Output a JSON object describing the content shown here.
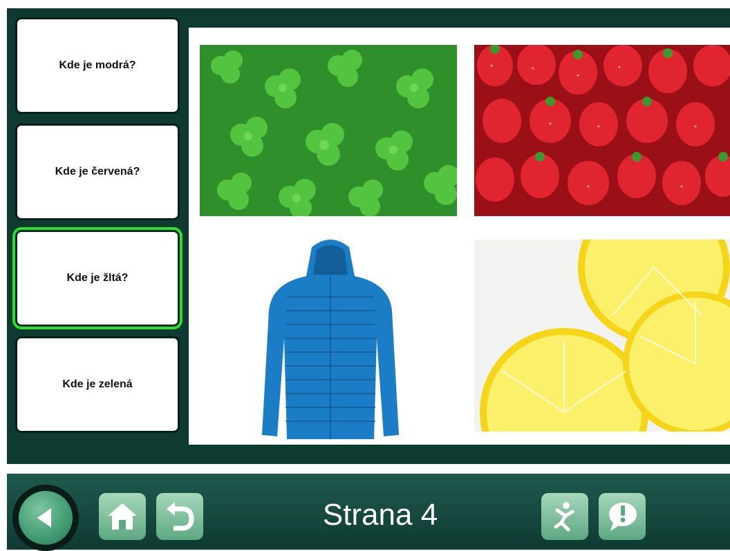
{
  "questions": [
    {
      "label": "Kde je modrá?",
      "selected": false
    },
    {
      "label": "Kde je červená?",
      "selected": false
    },
    {
      "label": "Kde je žltá?",
      "selected": true
    },
    {
      "label": "Kde je zelená",
      "selected": false
    }
  ],
  "images": [
    {
      "name": "clover-leaves-image",
      "color": "#3aa83a"
    },
    {
      "name": "strawberries-image",
      "color": "#d81e2a"
    },
    {
      "name": "blue-jacket-image",
      "color": "#1b7dc6"
    },
    {
      "name": "lemon-slices-image",
      "color": "#f7e33a"
    }
  ],
  "toolbar": {
    "page_label": "Strana 4",
    "icons": [
      "back-arrow-icon",
      "home-icon",
      "undo-icon",
      "activity-icon",
      "alert-bubble-icon"
    ]
  },
  "colors": {
    "panel": "#0f3a32",
    "selected_outline": "#2ee02e",
    "button_green": "#5ea884"
  }
}
